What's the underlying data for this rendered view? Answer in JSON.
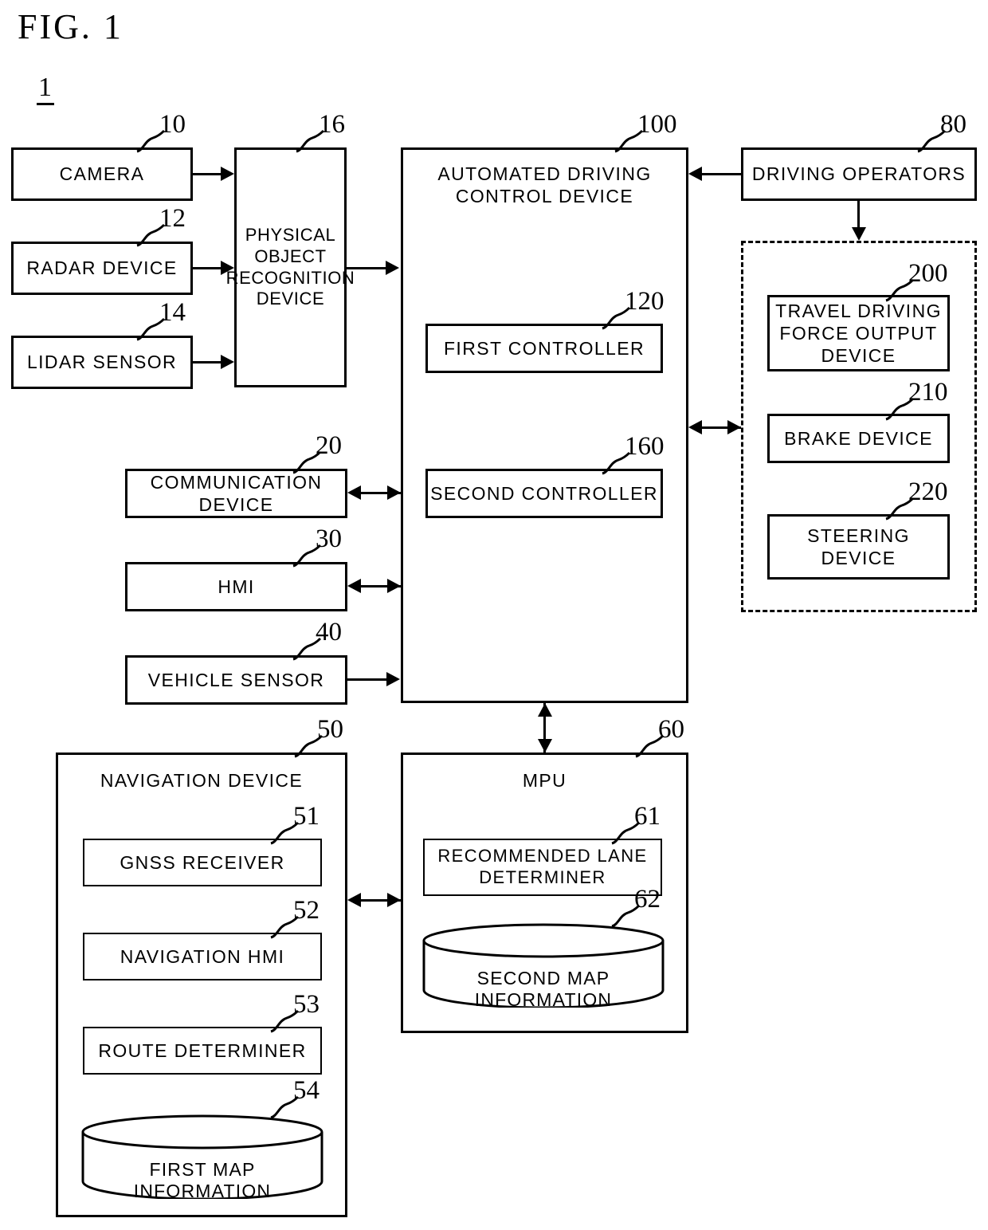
{
  "figure": {
    "title": "FIG. 1",
    "system_number": "1"
  },
  "blocks": {
    "camera": {
      "label": "CAMERA",
      "ref": "10"
    },
    "radar": {
      "label": "RADAR DEVICE",
      "ref": "12"
    },
    "lidar": {
      "label": "LIDAR SENSOR",
      "ref": "14"
    },
    "object_recog": {
      "label": "PHYSICAL\nOBJECT\nRECOGNITION\nDEVICE",
      "ref": "16"
    },
    "comm": {
      "label": "COMMUNICATION\nDEVICE",
      "ref": "20"
    },
    "hmi": {
      "label": "HMI",
      "ref": "30"
    },
    "vehicle_sensor": {
      "label": "VEHICLE SENSOR",
      "ref": "40"
    },
    "adc": {
      "label": "AUTOMATED DRIVING\nCONTROL DEVICE",
      "ref": "100"
    },
    "first_ctrl": {
      "label": "FIRST CONTROLLER",
      "ref": "120"
    },
    "second_ctrl": {
      "label": "SECOND CONTROLLER",
      "ref": "160"
    },
    "driving_ops": {
      "label": "DRIVING OPERATORS",
      "ref": "80"
    },
    "travel_force": {
      "label": "TRAVEL DRIVING\nFORCE OUTPUT\nDEVICE",
      "ref": "200"
    },
    "brake": {
      "label": "BRAKE DEVICE",
      "ref": "210"
    },
    "steering": {
      "label": "STEERING\nDEVICE",
      "ref": "220"
    },
    "nav": {
      "label": "NAVIGATION DEVICE",
      "ref": "50"
    },
    "gnss": {
      "label": "GNSS RECEIVER",
      "ref": "51"
    },
    "nav_hmi": {
      "label": "NAVIGATION HMI",
      "ref": "52"
    },
    "route_det": {
      "label": "ROUTE DETERMINER",
      "ref": "53"
    },
    "first_map": {
      "label": "FIRST MAP INFORMATION",
      "ref": "54"
    },
    "mpu": {
      "label": "MPU",
      "ref": "60"
    },
    "rec_lane": {
      "label": "RECOMMENDED LANE\nDETERMINER",
      "ref": "61"
    },
    "second_map": {
      "label": "SECOND MAP INFORMATION",
      "ref": "62"
    }
  },
  "connections": [
    {
      "from": "camera",
      "to": "object_recog",
      "type": "arrow-right"
    },
    {
      "from": "radar",
      "to": "object_recog",
      "type": "arrow-right"
    },
    {
      "from": "lidar",
      "to": "object_recog",
      "type": "arrow-right"
    },
    {
      "from": "object_recog",
      "to": "adc",
      "type": "arrow-right"
    },
    {
      "from": "comm",
      "to": "adc",
      "type": "bidirectional"
    },
    {
      "from": "hmi",
      "to": "adc",
      "type": "bidirectional"
    },
    {
      "from": "vehicle_sensor",
      "to": "adc",
      "type": "arrow-right"
    },
    {
      "from": "driving_ops",
      "to": "adc",
      "type": "arrow-left"
    },
    {
      "from": "driving_ops",
      "to": "actuators",
      "type": "arrow-down"
    },
    {
      "from": "adc",
      "to": "actuators",
      "type": "bidirectional"
    },
    {
      "from": "adc",
      "to": "mpu",
      "type": "bidirectional"
    },
    {
      "from": "nav",
      "to": "mpu",
      "type": "bidirectional"
    }
  ],
  "colors": {
    "stroke": "#000000",
    "background": "#ffffff"
  }
}
